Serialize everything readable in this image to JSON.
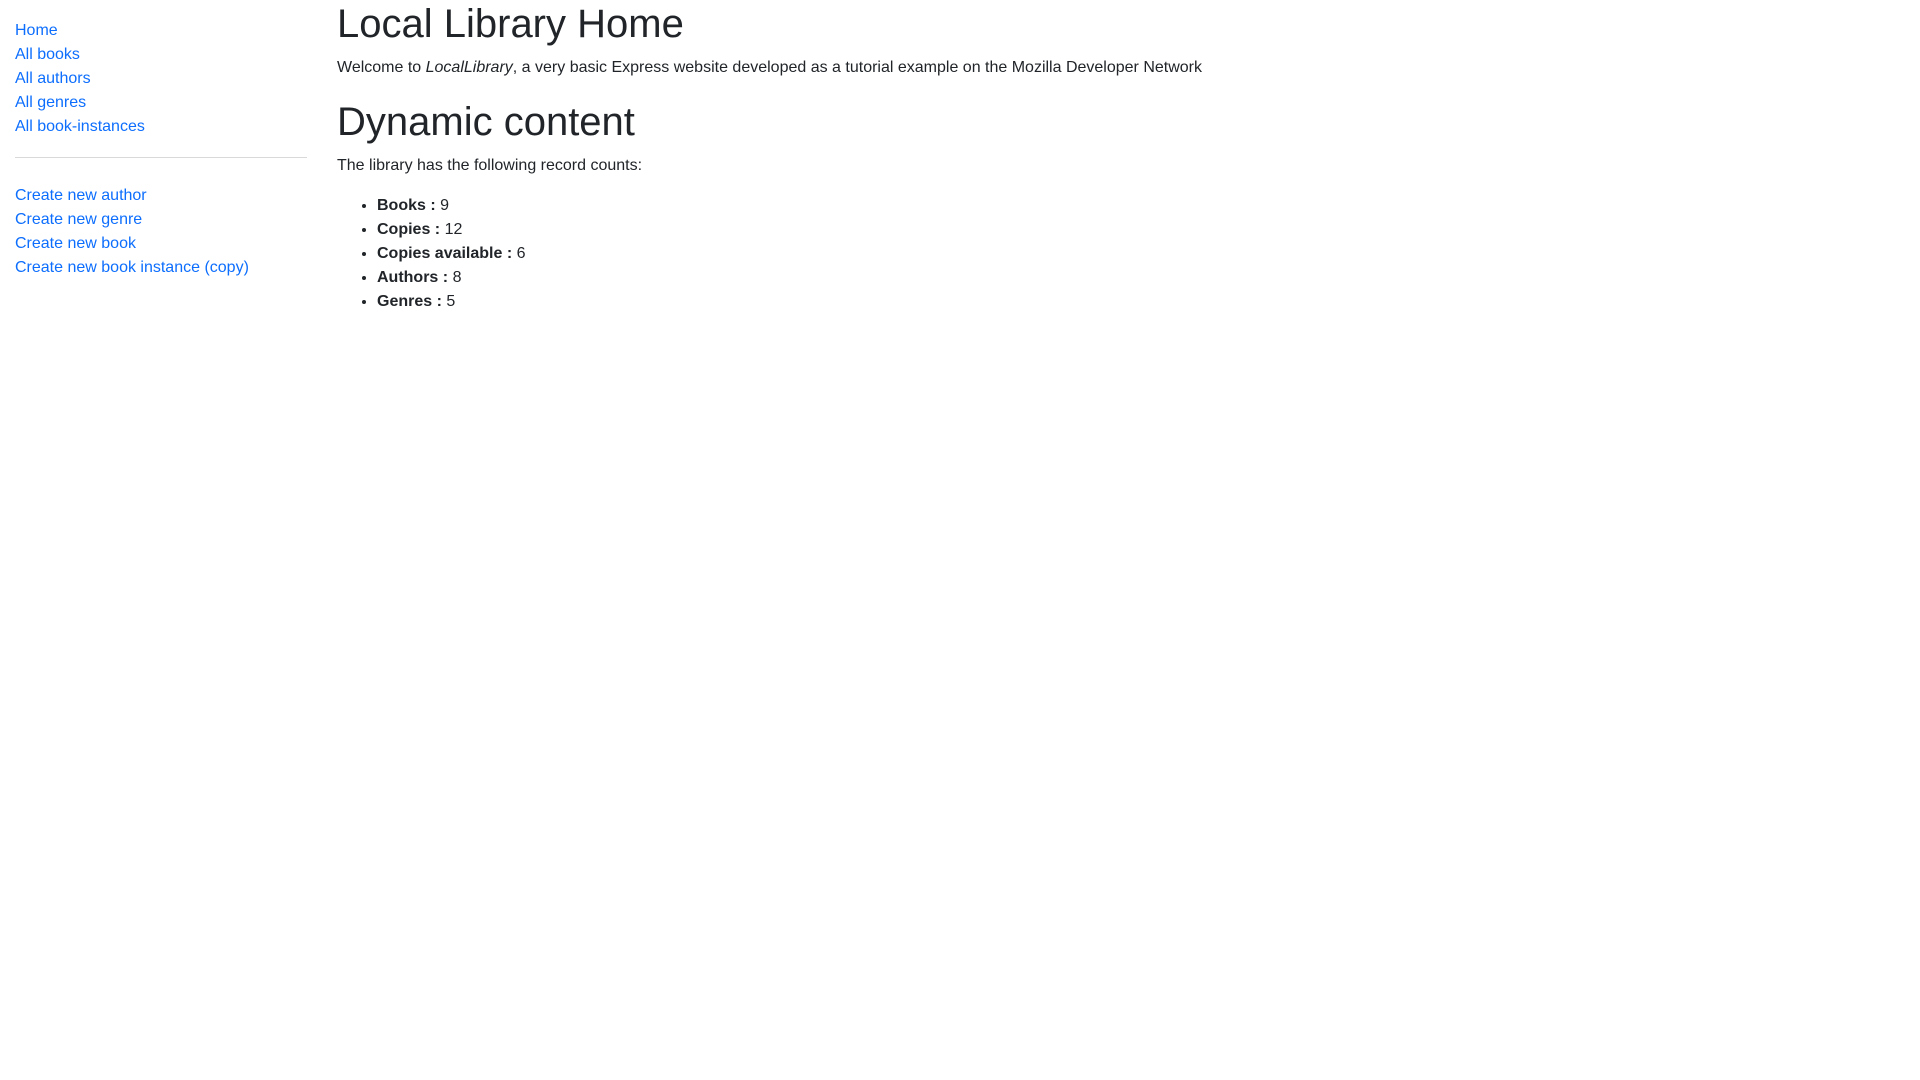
{
  "sidebar": {
    "primary_links": [
      {
        "label": "Home"
      },
      {
        "label": "All books"
      },
      {
        "label": "All authors"
      },
      {
        "label": "All genres"
      },
      {
        "label": "All book-instances"
      }
    ],
    "create_links": [
      {
        "label": "Create new author"
      },
      {
        "label": "Create new genre"
      },
      {
        "label": "Create new book"
      },
      {
        "label": "Create new book instance (copy)"
      }
    ]
  },
  "main": {
    "title": "Local Library Home",
    "welcome": {
      "prefix": "Welcome to ",
      "brand": "LocalLibrary",
      "suffix": ", a very basic Express website developed as a tutorial example on the Mozilla Developer Network"
    },
    "dynamic_heading": "Dynamic content",
    "counts_intro": "The library has the following record counts:",
    "counts": [
      {
        "label": "Books :",
        "value": "9"
      },
      {
        "label": "Copies :",
        "value": "12"
      },
      {
        "label": "Copies available :",
        "value": "6"
      },
      {
        "label": "Authors :",
        "value": "8"
      },
      {
        "label": "Genres :",
        "value": "5"
      }
    ]
  },
  "colors": {
    "link": "#0d6efd",
    "text": "#212529",
    "divider": "#d9d9d9"
  }
}
